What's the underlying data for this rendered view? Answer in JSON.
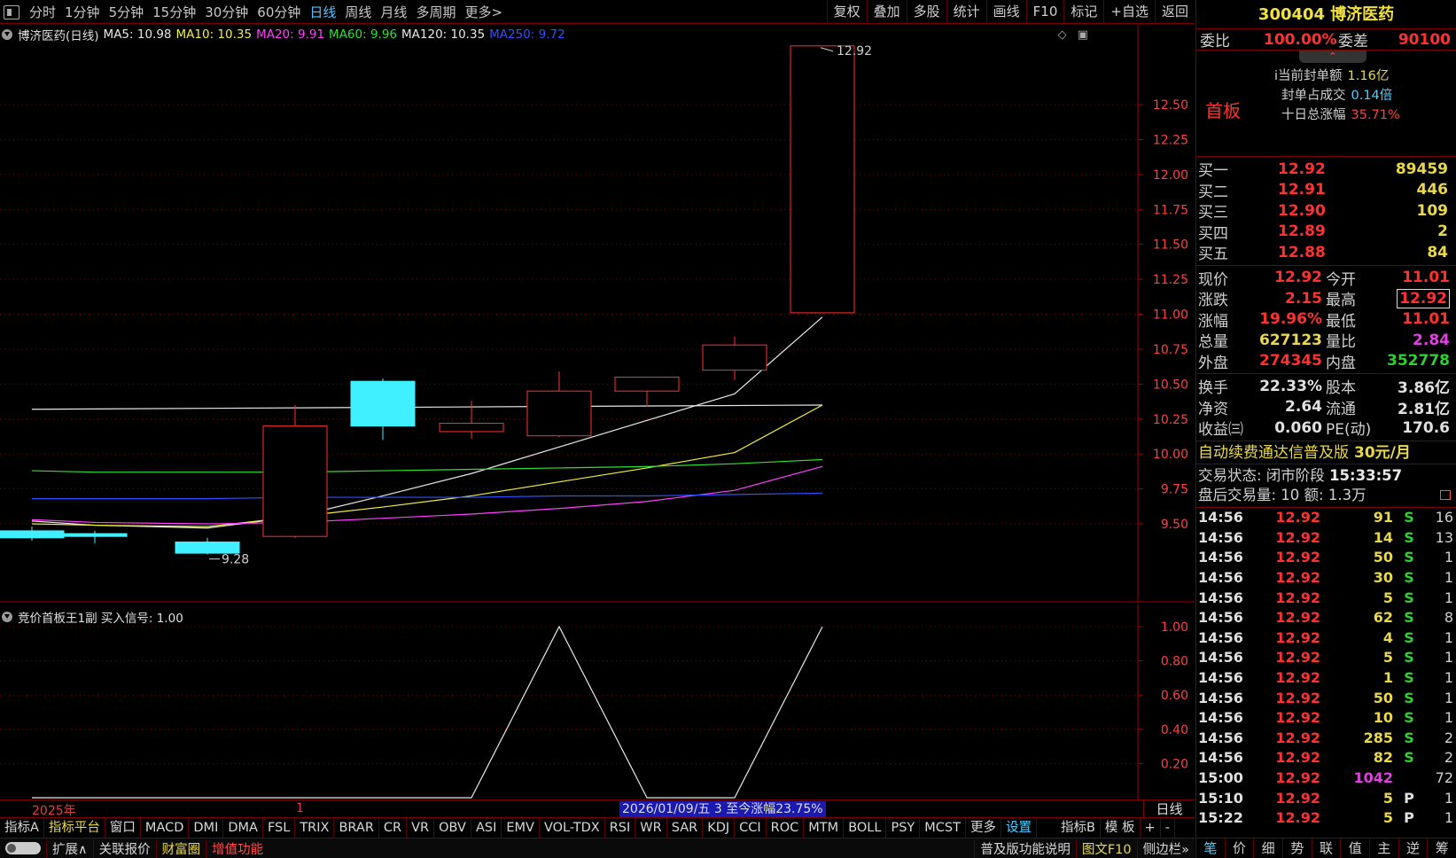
{
  "toolbar": {
    "periods": [
      "分时",
      "1分钟",
      "5分钟",
      "15分钟",
      "30分钟",
      "60分钟",
      "日线",
      "周线",
      "月线",
      "多周期",
      "更多>"
    ],
    "active_period": "日线",
    "right_buttons": [
      "复权",
      "叠加",
      "多股",
      "统计",
      "画线",
      "F10",
      "标记",
      "+自选",
      "返回"
    ]
  },
  "main_chart": {
    "name": "博济医药(日线)",
    "ma": [
      {
        "label": "MA5: 10.98",
        "color": "#e8e8e8"
      },
      {
        "label": "MA10: 10.35",
        "color": "#f0f040"
      },
      {
        "label": "MA20: 9.91",
        "color": "#ff40ff"
      },
      {
        "label": "MA60: 9.96",
        "color": "#30e030"
      },
      {
        "label": "MA120: 10.35",
        "color": "#e8e8e8"
      },
      {
        "label": "MA250: 9.72",
        "color": "#3050ff"
      }
    ],
    "icons": [
      "diamond-icon",
      "panel-toggle-icon"
    ],
    "high_label": "12.92",
    "low_label": "9.28"
  },
  "chart_data": [
    {
      "type": "candlestick",
      "title": "博济医药(日线)",
      "y_ticks": [
        9.5,
        9.75,
        10.0,
        10.25,
        10.5,
        10.75,
        11.0,
        11.25,
        11.5,
        11.75,
        12.0,
        12.25,
        12.5
      ],
      "ylim": [
        9.2,
        13.0
      ],
      "candles": [
        {
          "open": 9.45,
          "close": 9.4,
          "high": 9.48,
          "low": 9.38,
          "up": false
        },
        {
          "open": 9.43,
          "close": 9.41,
          "high": 9.45,
          "low": 9.36,
          "up": false
        },
        {
          "open": 9.37,
          "close": 9.29,
          "high": 9.4,
          "low": 9.28,
          "up": false
        },
        {
          "open": 9.41,
          "close": 10.2,
          "high": 10.35,
          "low": 9.4,
          "up": true
        },
        {
          "open": 10.52,
          "close": 10.2,
          "high": 10.54,
          "low": 10.1,
          "up": false
        },
        {
          "open": 10.16,
          "close": 10.22,
          "high": 10.38,
          "low": 10.11,
          "up": true
        },
        {
          "open": 10.13,
          "close": 10.45,
          "high": 10.59,
          "low": 10.12,
          "up": true
        },
        {
          "open": 10.45,
          "close": 10.55,
          "high": 10.55,
          "low": 10.34,
          "up": true
        },
        {
          "open": 10.6,
          "close": 10.78,
          "high": 10.84,
          "low": 10.53,
          "up": true
        },
        {
          "open": 11.01,
          "close": 12.92,
          "high": 12.92,
          "low": 11.01,
          "up": true
        }
      ],
      "series": [
        {
          "name": "MA5",
          "color": "#e8e8e8",
          "values": [
            9.52,
            9.49,
            9.47,
            9.55,
            9.7,
            9.86,
            10.05,
            10.24,
            10.43,
            10.98
          ]
        },
        {
          "name": "MA10",
          "color": "#f0f040",
          "values": [
            9.5,
            9.49,
            9.48,
            9.55,
            9.62,
            9.7,
            9.8,
            9.9,
            10.01,
            10.35
          ]
        },
        {
          "name": "MA20",
          "color": "#ff40ff",
          "values": [
            9.53,
            9.51,
            9.5,
            9.51,
            9.54,
            9.57,
            9.61,
            9.66,
            9.74,
            9.91
          ]
        },
        {
          "name": "MA60",
          "color": "#30e030",
          "values": [
            9.88,
            9.87,
            9.87,
            9.87,
            9.88,
            9.89,
            9.9,
            9.91,
            9.93,
            9.96
          ]
        },
        {
          "name": "MA120",
          "color": "#e8e8e8",
          "values": [
            10.32,
            10.32,
            10.32,
            10.32,
            10.32,
            10.32,
            10.33,
            10.33,
            10.34,
            10.35
          ]
        },
        {
          "name": "MA250",
          "color": "#3050ff",
          "values": [
            9.68,
            9.68,
            9.68,
            9.69,
            9.69,
            9.69,
            9.7,
            9.7,
            9.71,
            9.72
          ]
        }
      ]
    },
    {
      "type": "line",
      "title": "竞价首板王1副",
      "y_ticks": [
        0.2,
        0.4,
        0.6,
        0.8,
        1.0
      ],
      "ylim": [
        0,
        1.0
      ],
      "series": [
        {
          "name": "买入信号",
          "color": "#e8e8e8",
          "values": [
            0,
            0,
            0,
            0,
            0,
            0,
            1,
            0,
            0,
            1
          ]
        }
      ]
    }
  ],
  "indicator": {
    "legend": "竞价首板王1副  买入信号: 1.00"
  },
  "datebar": {
    "year": "2025年",
    "month": "1",
    "range_label": "2026/01/09/五 3 至今涨幅23.75%",
    "period": "日线"
  },
  "indicator_tabs": [
    {
      "label": "指标A",
      "style": "white"
    },
    {
      "label": "指标平台",
      "style": "yellow"
    },
    {
      "label": "窗口",
      "style": "white"
    },
    {
      "label": "MACD",
      "style": "white"
    },
    {
      "label": "DMI",
      "style": "white"
    },
    {
      "label": "DMA",
      "style": "white"
    },
    {
      "label": "FSL",
      "style": "white"
    },
    {
      "label": "TRIX",
      "style": "white"
    },
    {
      "label": "BRAR",
      "style": "white"
    },
    {
      "label": "CR",
      "style": "white"
    },
    {
      "label": "VR",
      "style": "white"
    },
    {
      "label": "OBV",
      "style": "white"
    },
    {
      "label": "ASI",
      "style": "white"
    },
    {
      "label": "EMV",
      "style": "white"
    },
    {
      "label": "VOL-TDX",
      "style": "white"
    },
    {
      "label": "RSI",
      "style": "white"
    },
    {
      "label": "WR",
      "style": "white"
    },
    {
      "label": "SAR",
      "style": "white"
    },
    {
      "label": "KDJ",
      "style": "white"
    },
    {
      "label": "CCI",
      "style": "white"
    },
    {
      "label": "ROC",
      "style": "white"
    },
    {
      "label": "MTM",
      "style": "white"
    },
    {
      "label": "BOLL",
      "style": "white"
    },
    {
      "label": "PSY",
      "style": "white"
    },
    {
      "label": "MCST",
      "style": "white"
    },
    {
      "label": "更多",
      "style": "white"
    },
    {
      "label": "设置",
      "style": "cyan"
    },
    {
      "label": "指标B",
      "style": "white"
    },
    {
      "label": "模 板",
      "style": "white"
    },
    {
      "label": "+",
      "style": "white"
    },
    {
      "label": "-",
      "style": "white"
    }
  ],
  "statusbar": {
    "left": [
      {
        "label": "扩展∧",
        "style": "white"
      },
      {
        "label": "关联报价",
        "style": "white"
      },
      {
        "label": "财富圈",
        "style": "yellow"
      },
      {
        "label": "增值功能",
        "style": "red"
      }
    ],
    "right": [
      {
        "label": "普及版功能说明",
        "style": "white"
      },
      {
        "label": "图文F10",
        "style": "yellow"
      },
      {
        "label": "侧边栏»",
        "style": "white"
      }
    ]
  },
  "quote": {
    "code": "300404",
    "name": "博济医药",
    "wb_label": "委比",
    "wb_value": "100.00%",
    "wc_label": "委差",
    "wc_value": "90100",
    "board": "首板",
    "seal_label": "当前封单额",
    "seal_value": "1.16亿",
    "ratio_label": "封单占成交",
    "ratio_value": "0.14倍",
    "ten_day_label": "十日总涨幅",
    "ten_day_value": "35.71%",
    "bids": [
      {
        "label": "买一",
        "price": "12.92",
        "vol": "89459"
      },
      {
        "label": "买二",
        "price": "12.91",
        "vol": "446"
      },
      {
        "label": "买三",
        "price": "12.90",
        "vol": "109"
      },
      {
        "label": "买四",
        "price": "12.89",
        "vol": "2"
      },
      {
        "label": "买五",
        "price": "12.88",
        "vol": "84"
      }
    ],
    "rows": [
      {
        "l1": "现价",
        "v1": "12.92",
        "c1": "red",
        "l2": "今开",
        "v2": "11.01",
        "c2": "red",
        "box": false
      },
      {
        "l1": "涨跌",
        "v1": "2.15",
        "c1": "red",
        "l2": "最高",
        "v2": "12.92",
        "c2": "red",
        "box": true
      },
      {
        "l1": "涨幅",
        "v1": "19.96%",
        "c1": "red",
        "l2": "最低",
        "v2": "11.01",
        "c2": "red",
        "box": false
      },
      {
        "l1": "总量",
        "v1": "627123",
        "c1": "yel",
        "l2": "量比",
        "v2": "2.84",
        "c2": "mag",
        "box": false
      },
      {
        "l1": "外盘",
        "v1": "274345",
        "c1": "red",
        "l2": "内盘",
        "v2": "352778",
        "c2": "grn",
        "box": false
      }
    ],
    "fin": [
      {
        "l1": "换手",
        "v1": "22.33%",
        "l2": "股本",
        "v2": "3.86亿"
      },
      {
        "l1": "净资",
        "v1": "2.64",
        "l2": "流通",
        "v2": "2.81亿"
      },
      {
        "l1": "收益㈢",
        "v1": "0.060",
        "l2": "PE(动)",
        "v2": "170.6"
      }
    ],
    "ad_text": "自动续费通达信普及版",
    "ad_price": "30元/月",
    "status_label": "交易状态: 闭市阶段",
    "status_time": "15:33:57",
    "after_label": "盘后交易量: 10  额: 1.3万"
  },
  "ticks": [
    {
      "t": "14:56",
      "p": "12.92",
      "v": "91",
      "vc": "yel",
      "f": "S",
      "n": "16"
    },
    {
      "t": "14:56",
      "p": "12.92",
      "v": "14",
      "vc": "yel",
      "f": "S",
      "n": "13"
    },
    {
      "t": "14:56",
      "p": "12.92",
      "v": "50",
      "vc": "yel",
      "f": "S",
      "n": "1"
    },
    {
      "t": "14:56",
      "p": "12.92",
      "v": "30",
      "vc": "yel",
      "f": "S",
      "n": "1"
    },
    {
      "t": "14:56",
      "p": "12.92",
      "v": "5",
      "vc": "yel",
      "f": "S",
      "n": "1"
    },
    {
      "t": "14:56",
      "p": "12.92",
      "v": "62",
      "vc": "yel",
      "f": "S",
      "n": "8"
    },
    {
      "t": "14:56",
      "p": "12.92",
      "v": "4",
      "vc": "yel",
      "f": "S",
      "n": "1"
    },
    {
      "t": "14:56",
      "p": "12.92",
      "v": "5",
      "vc": "yel",
      "f": "S",
      "n": "1"
    },
    {
      "t": "14:56",
      "p": "12.92",
      "v": "1",
      "vc": "yel",
      "f": "S",
      "n": "1"
    },
    {
      "t": "14:56",
      "p": "12.92",
      "v": "50",
      "vc": "yel",
      "f": "S",
      "n": "1"
    },
    {
      "t": "14:56",
      "p": "12.92",
      "v": "10",
      "vc": "yel",
      "f": "S",
      "n": "1"
    },
    {
      "t": "14:56",
      "p": "12.92",
      "v": "285",
      "vc": "yel",
      "f": "S",
      "n": "2"
    },
    {
      "t": "14:56",
      "p": "12.92",
      "v": "82",
      "vc": "yel",
      "f": "S",
      "n": "2"
    },
    {
      "t": "15:00",
      "p": "12.92",
      "v": "1042",
      "vc": "mag",
      "f": "",
      "n": "72"
    },
    {
      "t": "15:10",
      "p": "12.92",
      "v": "5",
      "vc": "yel",
      "f": "P",
      "n": "1"
    },
    {
      "t": "15:22",
      "p": "12.92",
      "v": "5",
      "vc": "yel",
      "f": "P",
      "n": "1"
    }
  ],
  "side_tabs": [
    "笔",
    "价",
    "细",
    "势",
    "联",
    "值",
    "主",
    "逆",
    "筹"
  ],
  "active_side_tab": "笔"
}
